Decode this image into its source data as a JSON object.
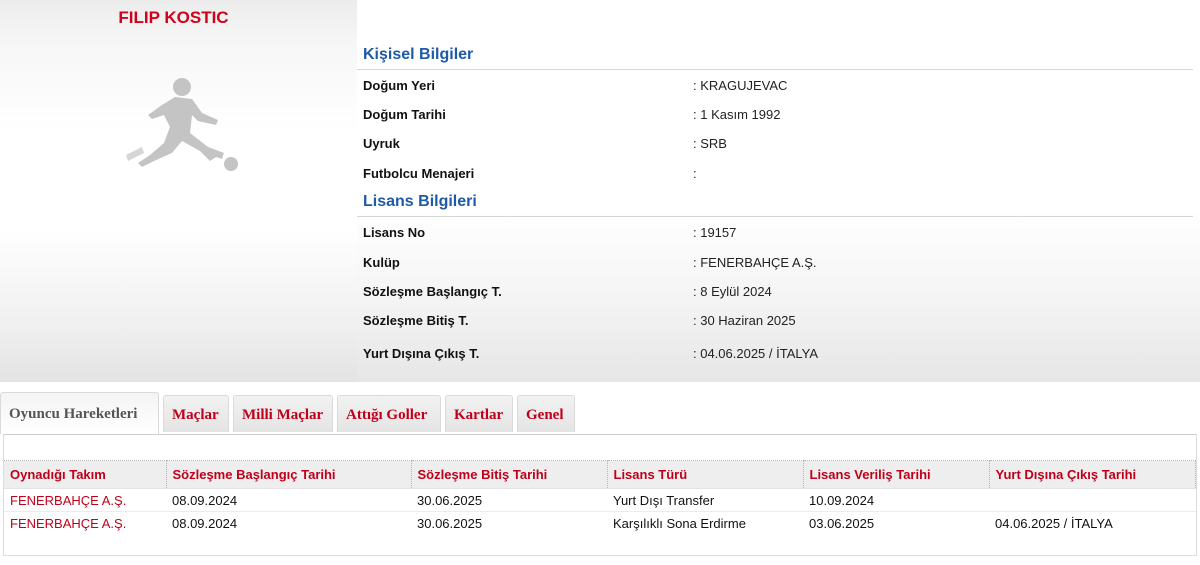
{
  "player": {
    "name": "FILIP KOSTIC"
  },
  "personal": {
    "title": "Kişisel Bilgiler",
    "rows": [
      {
        "label": "Doğum Yeri",
        "value": ":  KRAGUJEVAC"
      },
      {
        "label": "Doğum Tarihi",
        "value": ":  1 Kasım 1992"
      },
      {
        "label": "Uyruk",
        "value": ":  SRB"
      },
      {
        "label": "Futbolcu Menajeri",
        "value": ":"
      }
    ]
  },
  "license": {
    "title": "Lisans Bilgileri",
    "rows": [
      {
        "label": "Lisans No",
        "value": ": 19157"
      },
      {
        "label": "Kulüp",
        "value": ": FENERBAHÇE A.Ş."
      },
      {
        "label": "Sözleşme Başlangıç T.",
        "value": ": 8 Eylül 2024"
      },
      {
        "label": "Sözleşme Bitiş T.",
        "value": ": 30 Haziran 2025"
      },
      {
        "label": "Yurt Dışına Çıkış T.",
        "value": ": 04.06.2025 / İTALYA"
      }
    ]
  },
  "tabs": [
    {
      "label": "Oyuncu Hareketleri",
      "active": true
    },
    {
      "label": "Maçlar"
    },
    {
      "label": "Milli Maçlar"
    },
    {
      "label": "Attığı Goller"
    },
    {
      "label": "Kartlar"
    },
    {
      "label": "Genel"
    }
  ],
  "table": {
    "headers": [
      "Oynadığı Takım",
      "Sözleşme Başlangıç Tarihi",
      "Sözleşme Bitiş Tarihi",
      "Lisans Türü",
      "Lisans Veriliş Tarihi",
      "Yurt Dışına Çıkış Tarihi"
    ],
    "rows": [
      [
        "FENERBAHÇE A.Ş.",
        "08.09.2024",
        "30.06.2025",
        "Yurt Dışı Transfer",
        "10.09.2024",
        ""
      ],
      [
        "FENERBAHÇE A.Ş.",
        "08.09.2024",
        "30.06.2025",
        "Karşılıklı Sona Erdirme",
        "03.06.2025",
        "04.06.2025 / İTALYA"
      ]
    ]
  },
  "colors": {
    "accent_red": "#c0001a",
    "title_blue": "#1e5aa8"
  },
  "icons": {
    "player_image": "football-player-silhouette-icon"
  }
}
